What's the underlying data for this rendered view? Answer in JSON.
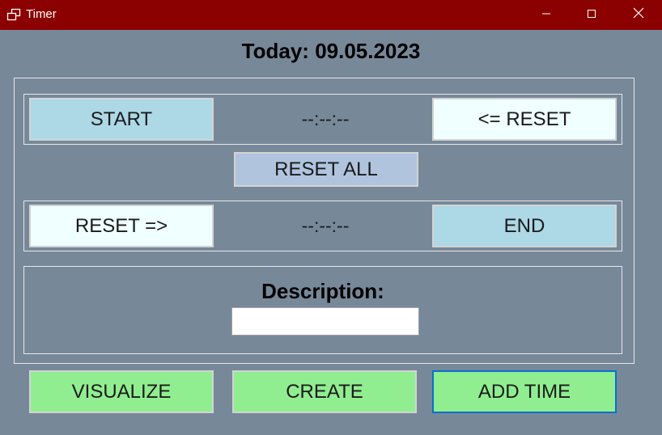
{
  "window": {
    "title": "Timer",
    "controls": {
      "minimize": "minimize-icon",
      "maximize": "maximize-icon",
      "close": "close-icon"
    }
  },
  "header": {
    "today": "Today: 09.05.2023"
  },
  "timers": {
    "start_label": "START",
    "start_time": "--:--:--",
    "reset_left_label": "<= RESET",
    "reset_all_label": "RESET ALL",
    "reset_right_label": "RESET =>",
    "end_time": "--:--:--",
    "end_label": "END"
  },
  "description": {
    "label": "Description:",
    "value": ""
  },
  "actions": {
    "visualize_label": "VISUALIZE",
    "create_label": "CREATE",
    "add_time_label": "ADD TIME"
  },
  "colors": {
    "titlebar": "#8b0000",
    "background": "#778899",
    "light_blue": "#add8e6",
    "azure": "#f0ffff",
    "steel_blue": "#b0c4de",
    "light_green": "#90ee90"
  }
}
